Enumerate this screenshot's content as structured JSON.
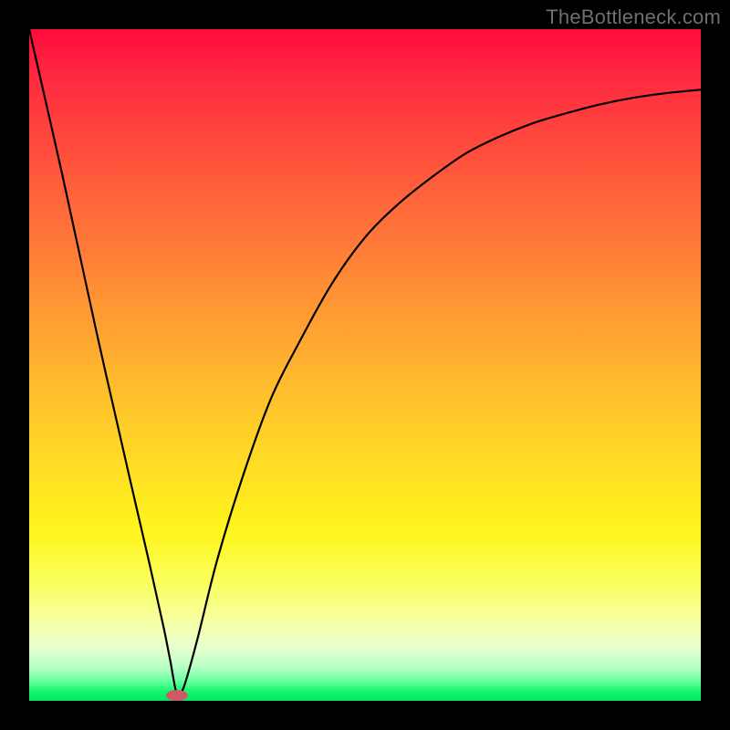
{
  "watermark": "TheBottleneck.com",
  "chart_data": {
    "type": "line",
    "title": "",
    "xlabel": "",
    "ylabel": "",
    "xlim": [
      0,
      100
    ],
    "ylim": [
      0,
      100
    ],
    "grid": false,
    "legend": false,
    "background_gradient": {
      "direction": "top-to-bottom",
      "stops": [
        {
          "pct": 0,
          "color": "#ff0b3e"
        },
        {
          "pct": 50,
          "color": "#ffb92e"
        },
        {
          "pct": 80,
          "color": "#fff51d"
        },
        {
          "pct": 100,
          "color": "#00e865"
        }
      ]
    },
    "series": [
      {
        "name": "bottleneck-curve",
        "x": [
          0,
          5,
          10,
          15,
          18,
          20,
          21,
          22,
          23,
          25,
          28,
          32,
          36,
          40,
          45,
          50,
          55,
          60,
          65,
          70,
          75,
          80,
          85,
          90,
          95,
          100
        ],
        "values": [
          100,
          78,
          55,
          33,
          20,
          11,
          6,
          1,
          2,
          9,
          21,
          34,
          45,
          53,
          62,
          69,
          74,
          78,
          81.5,
          84,
          86,
          87.5,
          88.8,
          89.8,
          90.5,
          91
        ]
      }
    ],
    "marker": {
      "name": "optimal-point",
      "x": 22,
      "y": 0.8,
      "color": "#cf5a66",
      "shape": "pill"
    }
  }
}
